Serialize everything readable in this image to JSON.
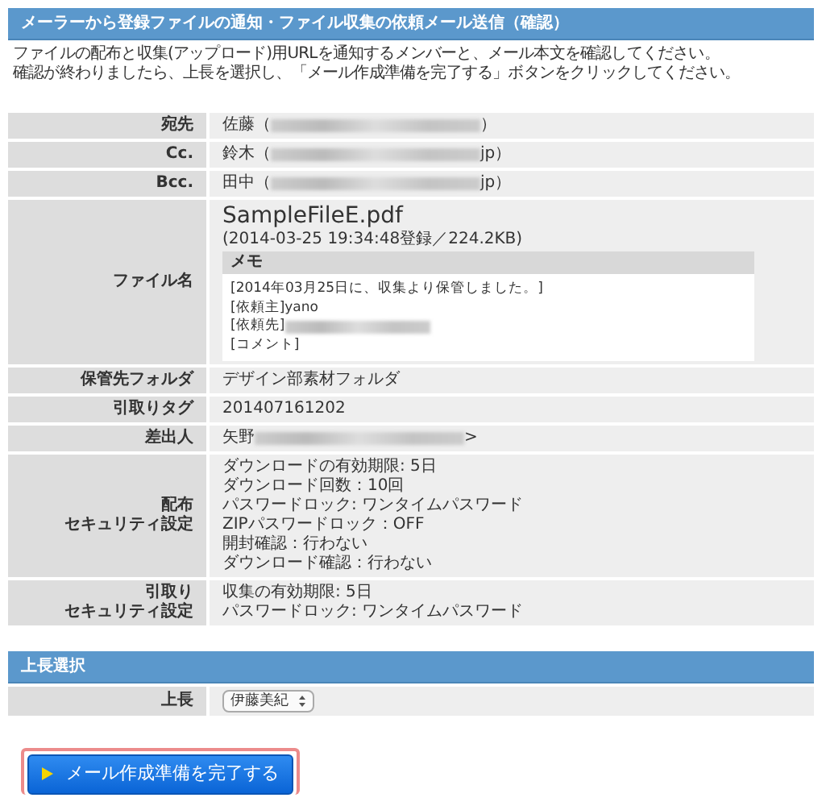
{
  "header": {
    "title": "メーラーから登録ファイルの通知・ファイル収集の依頼メール送信（確認）"
  },
  "intro": [
    "ファイルの配布と収集(アップロード)用URLを通知するメンバーと、メール本文を確認してください。",
    "確認が終わりましたら、上長を選択し、「メール作成準備を完了する」ボタンをクリックしてください。"
  ],
  "details": [
    {
      "kind": "person",
      "label": [
        "宛先"
      ],
      "prefix": "佐藤（",
      "suffix": "）"
    },
    {
      "kind": "person",
      "label": [
        "Cc."
      ],
      "prefix": "鈴木（",
      "suffix": "jp）"
    },
    {
      "kind": "person",
      "label": [
        "Bcc."
      ],
      "prefix": "田中（",
      "suffix": "jp）"
    },
    {
      "kind": "file",
      "label": [
        "ファイル名"
      ],
      "file_name": "SampleFileE.pdf",
      "file_info": "(2014-03-25 19:34:48登録／224.2KB)",
      "memo_title": "メモ",
      "memo_lines": [
        {
          "text": "[2014年03月25日に、収集より保管しました。]",
          "redacted": false
        },
        {
          "text": "[依頼主]yano",
          "redacted": false
        },
        {
          "text": "[依頼先]",
          "redacted": true
        },
        {
          "text": "[コメント]",
          "redacted": false
        }
      ]
    },
    {
      "kind": "lines",
      "label": [
        "保管先フォルダ"
      ],
      "lines": [
        "デザイン部素材フォルダ"
      ]
    },
    {
      "kind": "lines",
      "label": [
        "引取りタグ"
      ],
      "lines": [
        "201407161202"
      ]
    },
    {
      "kind": "person",
      "label": [
        "差出人"
      ],
      "prefix": "矢野",
      "suffix": ">"
    },
    {
      "kind": "lines",
      "label": [
        "配布",
        "セキュリティ設定"
      ],
      "lines": [
        "ダウンロードの有効期限: 5日",
        "ダウンロード回数：10回",
        "パスワードロック: ワンタイムパスワード",
        "ZIPパスワードロック：OFF",
        "開封確認：行わない",
        "ダウンロード確認：行わない"
      ]
    },
    {
      "kind": "lines",
      "label": [
        "引取り",
        "セキュリティ設定"
      ],
      "lines": [
        "収集の有効期限: 5日",
        "パスワードロック: ワンタイムパスワード"
      ]
    }
  ],
  "approval": {
    "title": "上長選択",
    "label": "上長",
    "value": "伊藤美紀"
  },
  "submit": {
    "label": "メール作成準備を完了する"
  }
}
